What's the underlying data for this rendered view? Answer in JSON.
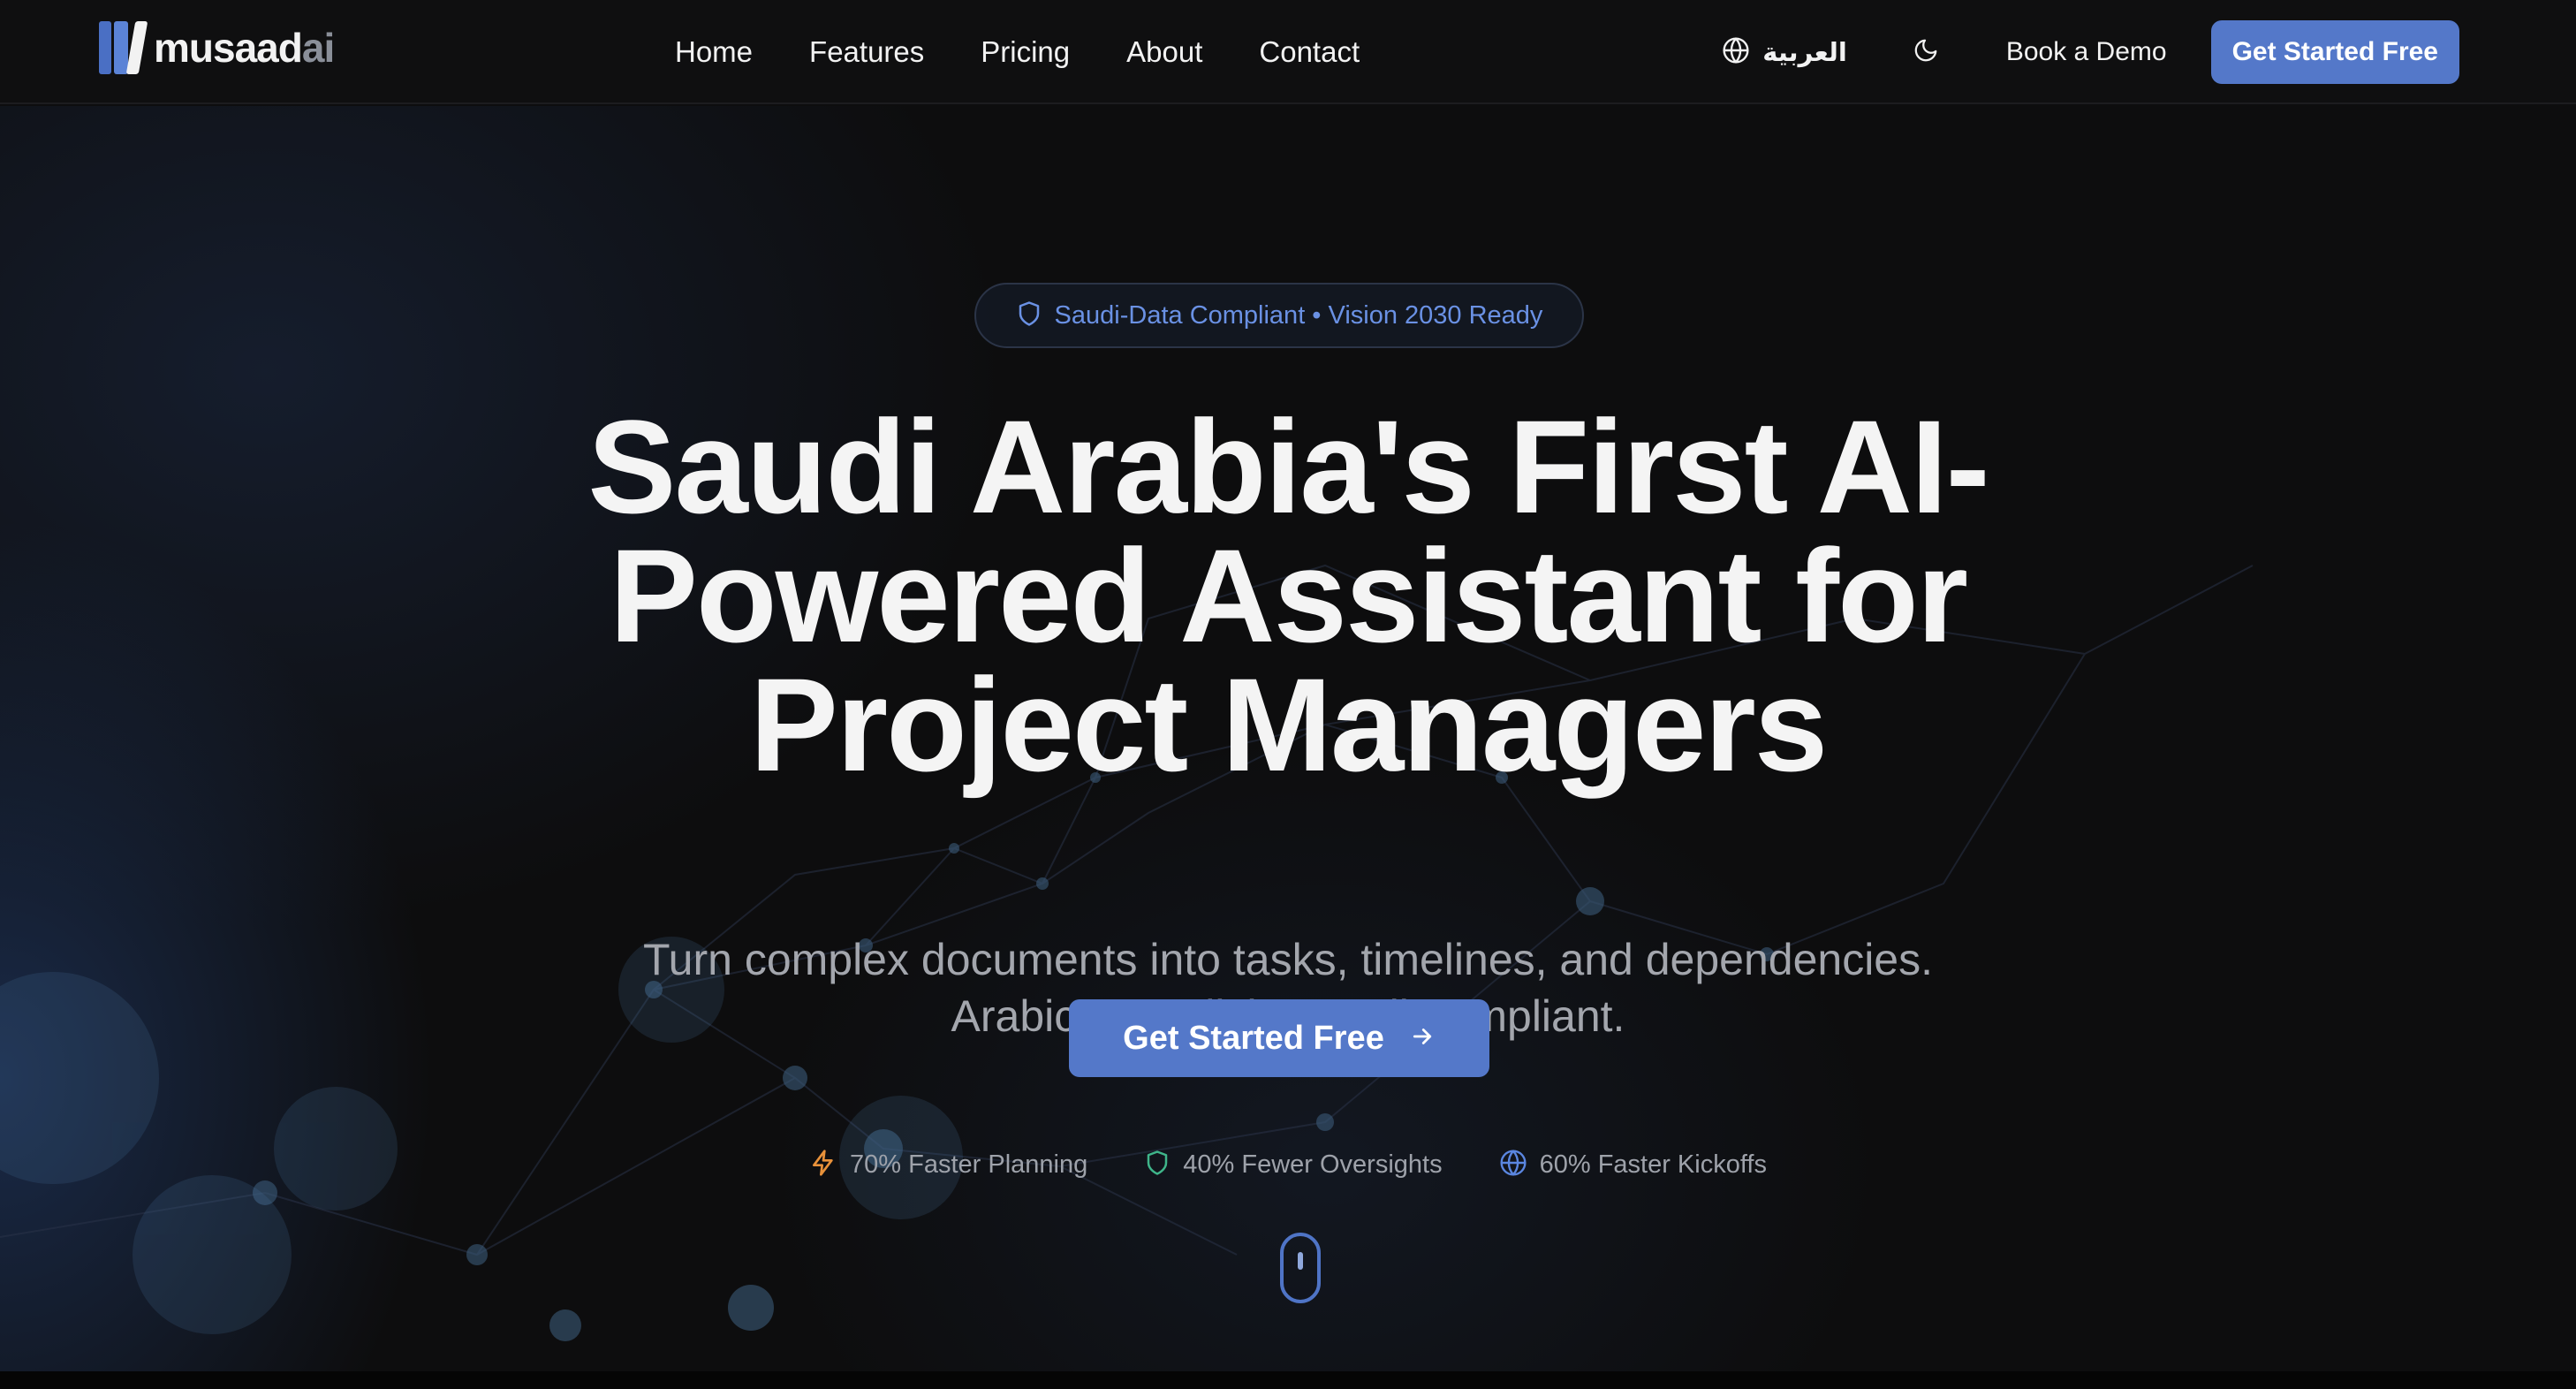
{
  "brand": {
    "name": "musaad",
    "suffix": "ai"
  },
  "nav": {
    "links": [
      "Home",
      "Features",
      "Pricing",
      "About",
      "Contact"
    ],
    "language_label": "العربية",
    "book_demo": "Book a Demo",
    "cta": "Get Started Free"
  },
  "hero": {
    "badge": "Saudi-Data Compliant • Vision 2030 Ready",
    "headline": [
      "Saudi Arabia's First AI-",
      "Powered Assistant for",
      "Project Managers"
    ],
    "subtitle": [
      "Turn complex documents into tasks, timelines, and dependencies.",
      "Arabic + English. Saudi-compliant."
    ],
    "cta": "Get Started Free",
    "stats": [
      {
        "label": "70% Faster Planning",
        "icon": "lightning-icon",
        "color": "#e8913a"
      },
      {
        "label": "40% Fewer Oversights",
        "icon": "shield-icon",
        "color": "#3fb58a"
      },
      {
        "label": "60% Faster Kickoffs",
        "icon": "globe-icon",
        "color": "#5a86e0"
      }
    ]
  },
  "colors": {
    "accent": "#5478c9",
    "badge_text": "#6a91e4",
    "background": "#0d0d0e"
  }
}
